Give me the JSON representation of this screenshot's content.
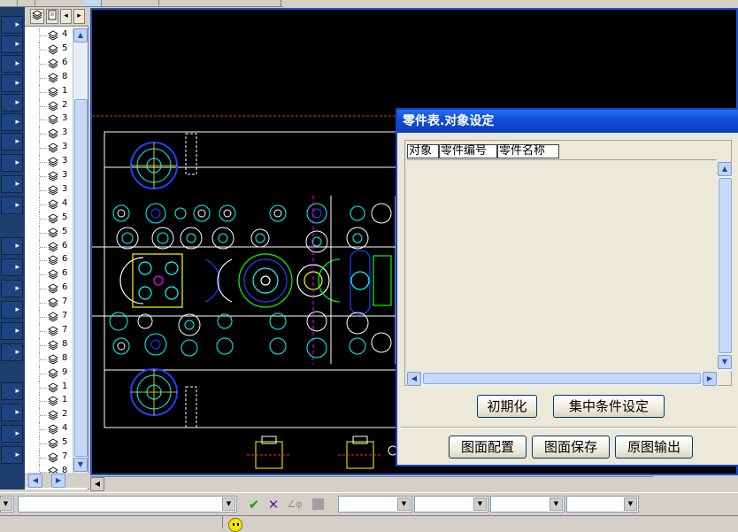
{
  "tree": {
    "tab_labels": [
      "◂",
      "▸"
    ],
    "items": [
      "4",
      "5",
      "6",
      "8",
      "1",
      "2",
      "3",
      "3",
      "3",
      "3",
      "3",
      "3",
      "4",
      "5",
      "5",
      "6",
      "6",
      "6",
      "6",
      "7",
      "7",
      "7",
      "8",
      "8",
      "9",
      "1",
      "1",
      "2",
      "4",
      "5",
      "7",
      "8",
      "1"
    ]
  },
  "left_buttons": [
    "▸",
    "▸",
    "▸",
    "▸",
    "▸",
    "▸",
    "▸",
    "▸",
    "▸",
    "▸",
    "▸",
    "▸",
    "▸",
    "▸",
    "▸",
    "▸",
    "▸",
    "▸",
    "▸",
    "▸"
  ],
  "dialog": {
    "title": "零件表.对象设定",
    "columns": [
      "对象",
      "零件编号",
      "零件名称"
    ],
    "btn_init": "初期化",
    "btn_condition": "集中条件设定",
    "btn_layout": "图面配置",
    "btn_save": "图面保存",
    "btn_output": "原图输出"
  },
  "toolbar": {
    "check_icon": "✔",
    "cross_icon": "✕",
    "angle_icon": "∠φ"
  },
  "colors": {
    "viewport_border": "#1e50c8",
    "title_bar": "#0a46d2",
    "cad_cyan": "#00ffff",
    "cad_blue": "#2040ff",
    "cad_yellow": "#ffff00",
    "cad_green": "#00ff00",
    "cad_magenta": "#ff00ff",
    "cad_red": "#ff2020"
  }
}
